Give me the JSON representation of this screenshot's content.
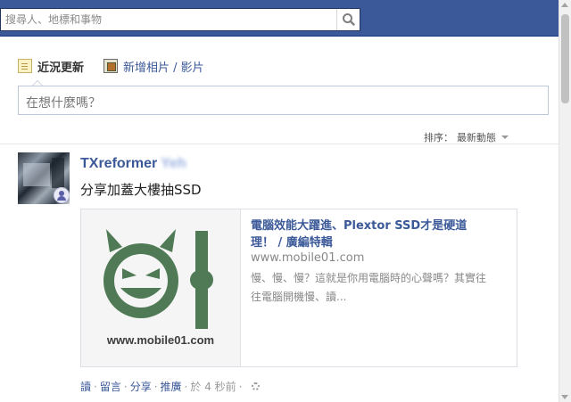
{
  "search": {
    "placeholder": "搜尋人、地標和事物",
    "button_icon": "search-icon"
  },
  "composer": {
    "tab_status_label": "近況更新",
    "tab_photo_label": "新增相片 / 影片",
    "placeholder": "在想什麼嗎？"
  },
  "feed": {
    "sort_label": "排序：",
    "sort_value": "最新動態",
    "post": {
      "author_first": "TXreformer",
      "author_last": "Yeh",
      "text": "分享加蓋大樓抽SSD",
      "share": {
        "title": "電腦效能大躍進、Plextor SSD才是硬道理！ / 廣編特輯",
        "domain": "www.mobile01.com",
        "description": "慢、慢、慢？這就是你用電腦時的心聲嗎？其實往往電腦開機慢、讀...",
        "thumb_text": "www.mobile01.com"
      },
      "actions": {
        "read": "讀",
        "comment": "留言",
        "share": "分享",
        "promote": "推廣",
        "time": "於 4 秒前"
      }
    }
  },
  "colors": {
    "brand": "#3b5998",
    "thumb_logo": "#4f7a55"
  }
}
